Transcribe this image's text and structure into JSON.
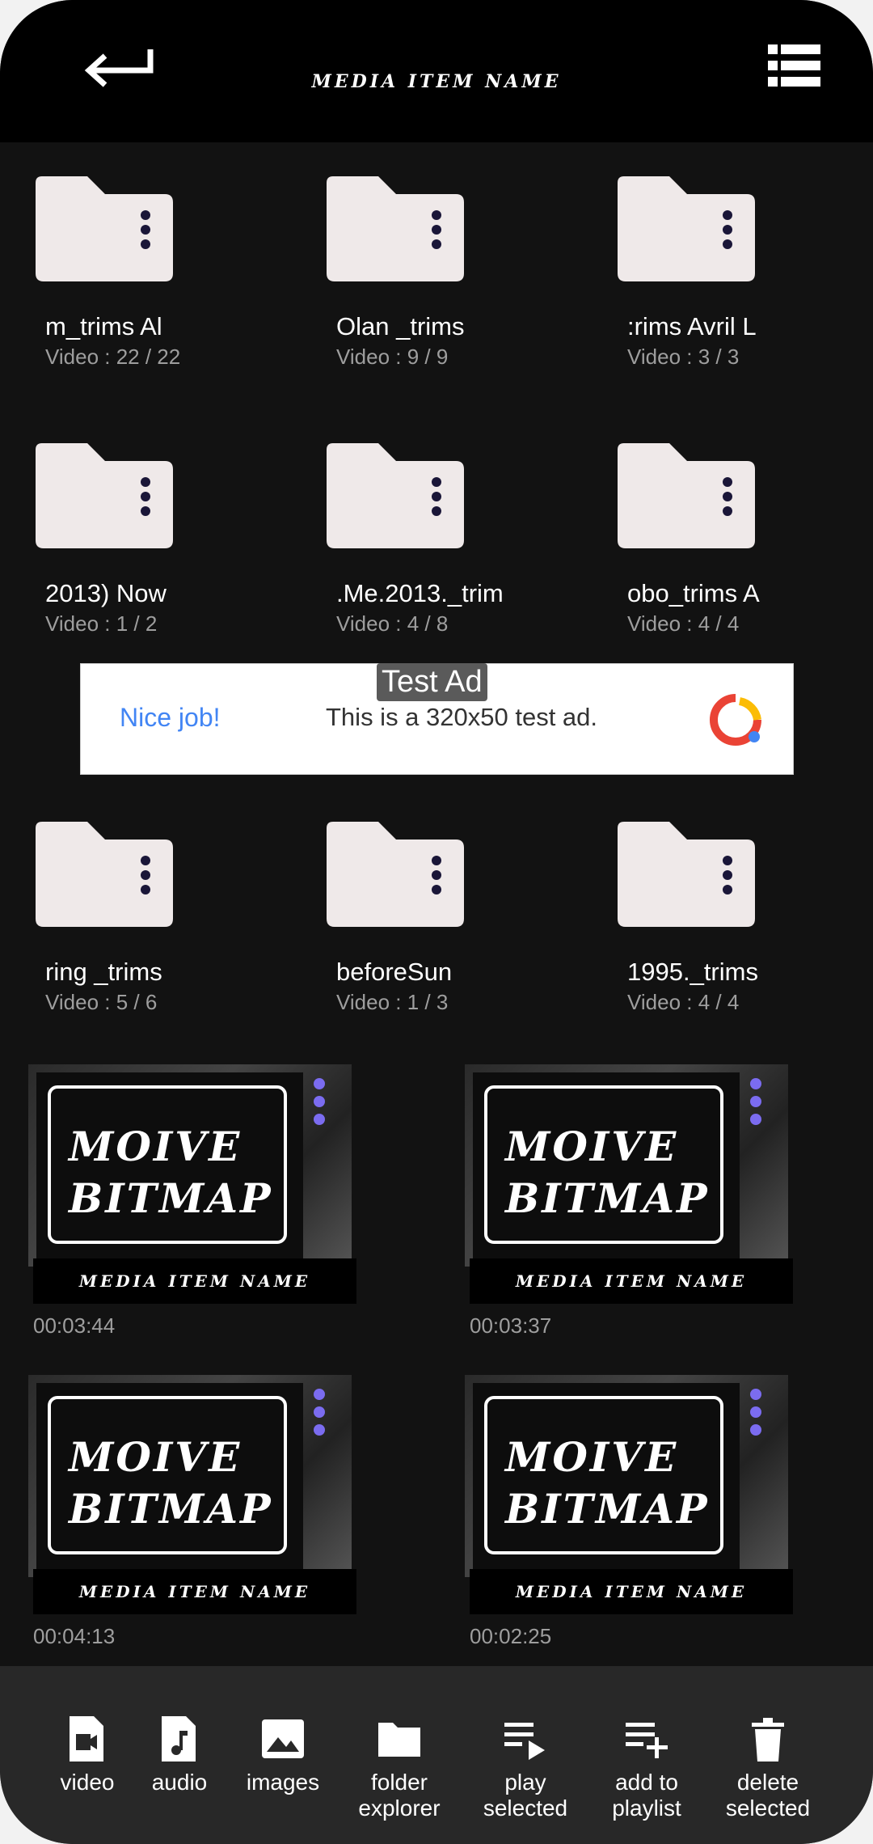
{
  "header": {
    "title": "MEDIA ITEM NAME",
    "back_icon": "back-arrow-icon",
    "list_icon": "list-view-icon"
  },
  "folders": [
    {
      "name": "m_trims        Al",
      "count": "Video : 22 / 22"
    },
    {
      "name": "Olan _trims",
      "count": "Video : 9 / 9"
    },
    {
      "name": ":rims        Avril L",
      "count": "Video : 3 / 3"
    },
    {
      "name": "2013)        Now",
      "count": "Video : 1 / 2"
    },
    {
      "name": ".Me.2013._trim",
      "count": "Video : 4 / 8"
    },
    {
      "name": "obo_trims        A",
      "count": "Video : 4 / 4"
    },
    {
      "name": "ring _trims",
      "count": "Video : 5 / 6"
    },
    {
      "name": "beforeSun",
      "count": "Video : 1 / 3"
    },
    {
      "name": "1995._trims",
      "count": "Video : 4 / 4"
    }
  ],
  "ad": {
    "tag": "Test Ad",
    "nice": "Nice job!",
    "text": "This is a 320x50 test ad."
  },
  "videos": [
    {
      "thumb_line1": "MOIVE",
      "thumb_line2": "BITMAP",
      "label": "MEDIA ITEM NAME",
      "duration": "00:03:44"
    },
    {
      "thumb_line1": "MOIVE",
      "thumb_line2": "BITMAP",
      "label": "MEDIA ITEM NAME",
      "duration": "00:03:37"
    },
    {
      "thumb_line1": "MOIVE",
      "thumb_line2": "BITMAP",
      "label": "MEDIA ITEM NAME",
      "duration": "00:04:13"
    },
    {
      "thumb_line1": "MOIVE",
      "thumb_line2": "BITMAP",
      "label": "MEDIA ITEM NAME",
      "duration": "00:02:25"
    }
  ],
  "bottom_nav": [
    {
      "label": "video",
      "icon": "video-file-icon"
    },
    {
      "label": "audio",
      "icon": "audio-file-icon"
    },
    {
      "label": "images",
      "icon": "image-icon"
    },
    {
      "label": "folder explorer",
      "icon": "folder-icon"
    },
    {
      "label": "play selected",
      "icon": "playlist-play-icon"
    },
    {
      "label": "add to playlist",
      "icon": "playlist-add-icon"
    },
    {
      "label": "delete selected",
      "icon": "trash-icon"
    }
  ],
  "colors": {
    "background": "#121212",
    "header": "#000000",
    "folder": "#efe9e9",
    "accent_dots": "#7b6cf0",
    "ad_blue": "#4285f4"
  }
}
